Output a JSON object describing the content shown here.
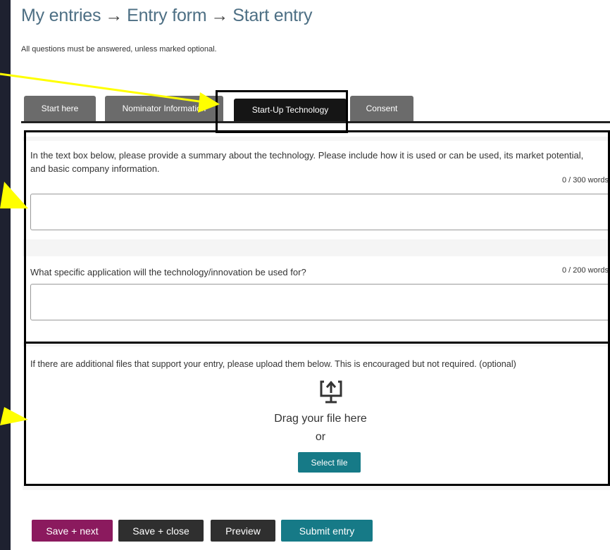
{
  "breadcrumb": {
    "items": [
      "My entries",
      "Entry form",
      "Start entry"
    ],
    "separator": "→"
  },
  "instructions": "All questions must be answered, unless marked optional.",
  "tabs": [
    {
      "label": "Start here",
      "active": false
    },
    {
      "label": "Nominator Information",
      "active": false
    },
    {
      "label": "Start-Up Technology",
      "active": true
    },
    {
      "label": "Consent",
      "active": false
    }
  ],
  "questions": [
    {
      "text": "In the text box below, please provide a summary about the technology. Please include how it is used or can be used, its market potential, and basic company information.",
      "counter": "0 / 300 words",
      "value": ""
    },
    {
      "text": "What specific application will the technology/innovation be used for?",
      "counter": "0 / 200 words",
      "value": ""
    }
  ],
  "upload": {
    "text": "If there are additional files that support your entry, please upload them below. This is encouraged but not required. (optional)",
    "drag_label": "Drag your file here",
    "or_label": "or",
    "select_label": "Select file",
    "icon": "upload-icon"
  },
  "actions": {
    "save_next": "Save + next",
    "save_close": "Save + close",
    "preview": "Preview",
    "submit": "Submit entry"
  },
  "colors": {
    "breadcrumb": "#4d6f84",
    "tab_inactive": "#6b6b6b",
    "tab_active": "#151515",
    "teal": "#167a87",
    "magenta": "#8b1a5e",
    "dark_button": "#2f2f2f",
    "annotation_arrow": "#ffff00"
  }
}
